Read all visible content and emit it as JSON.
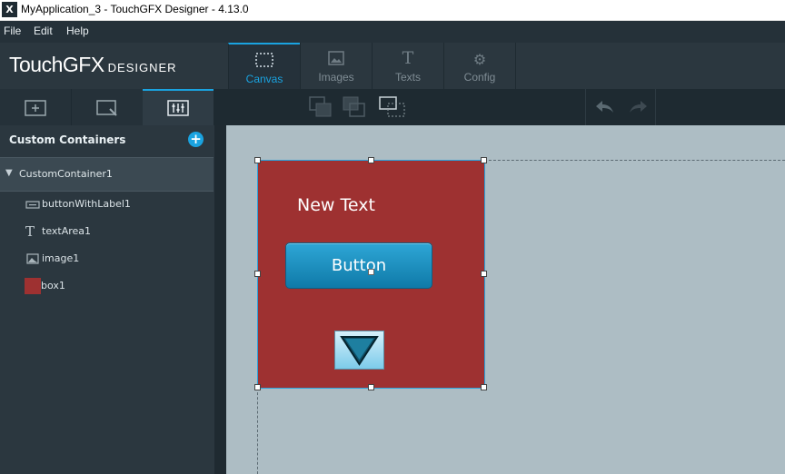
{
  "window": {
    "title": "MyApplication_3 - TouchGFX Designer - 4.13.0",
    "icon": "touchgfx-app-icon"
  },
  "menu": {
    "items": [
      "File",
      "Edit",
      "Help"
    ]
  },
  "logo": {
    "main": "TouchGFX",
    "sub": "DESIGNER"
  },
  "tabs": [
    {
      "label": "Canvas",
      "icon": "canvas-icon",
      "active": true
    },
    {
      "label": "Images",
      "icon": "images-icon",
      "active": false
    },
    {
      "label": "Texts",
      "icon": "texts-icon",
      "active": false
    },
    {
      "label": "Config",
      "icon": "config-gear-icon",
      "active": false
    }
  ],
  "panel": {
    "header": "Custom Containers",
    "tree": {
      "root": "CustomContainer1",
      "children": [
        {
          "label": "buttonWithLabel1",
          "icon": "button-icon"
        },
        {
          "label": "textArea1",
          "icon": "text-icon"
        },
        {
          "label": "image1",
          "icon": "image-icon"
        },
        {
          "label": "box1",
          "icon": "box-swatch-icon"
        }
      ]
    }
  },
  "canvas": {
    "text": "New Text",
    "button_label": "Button",
    "box_color": "#9e3131",
    "accent_color": "#1aa3e0"
  }
}
